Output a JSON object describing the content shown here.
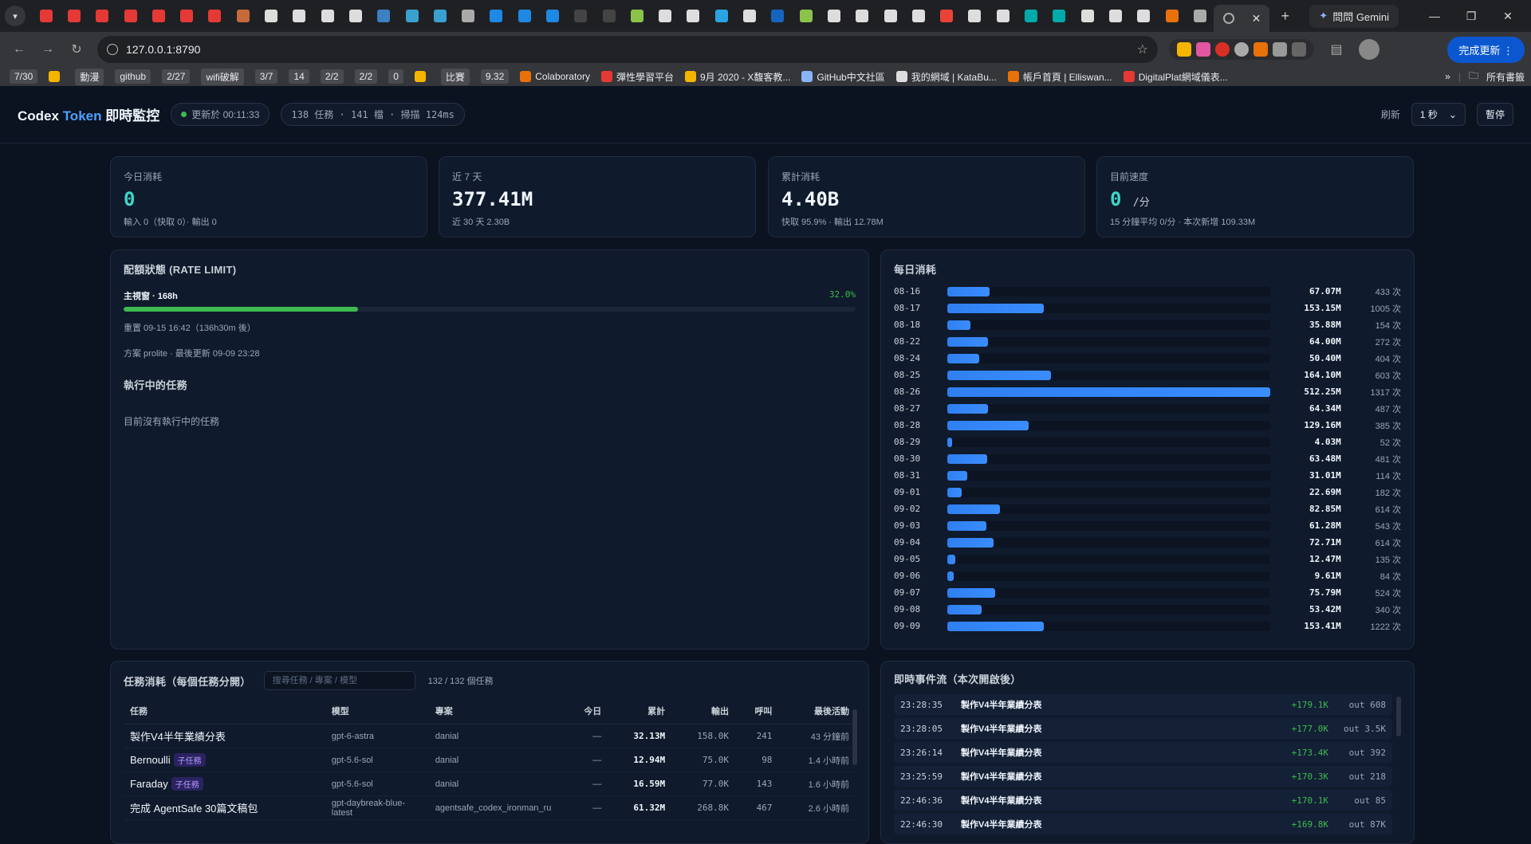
{
  "browser": {
    "gemini_label": "問問 Gemini",
    "url": "127.0.0.1:8790",
    "update_label": "完成更新",
    "bookmarks": [
      {
        "label": "7/30",
        "chip": true
      },
      {
        "label": "",
        "chip": false
      },
      {
        "label": "動漫",
        "chip": true
      },
      {
        "label": "github",
        "chip": true
      },
      {
        "label": "2/27",
        "chip": true
      },
      {
        "label": "wifi破解",
        "chip": true
      },
      {
        "label": "3/7",
        "chip": true
      },
      {
        "label": "14",
        "chip": true
      },
      {
        "label": "2/2",
        "chip": true
      },
      {
        "label": "2/2",
        "chip": true
      },
      {
        "label": "0",
        "chip": true
      },
      {
        "label": "",
        "chip": false
      },
      {
        "label": "比賽",
        "chip": true
      },
      {
        "label": "9.32",
        "chip": true
      },
      {
        "label": "Colaboratory",
        "chip": false
      },
      {
        "label": "彈性學習平台",
        "chip": false
      },
      {
        "label": "9月 2020 - X馥客教...",
        "chip": false
      },
      {
        "label": "GitHub中文社區",
        "chip": false
      },
      {
        "label": "我的網域 | KataBu...",
        "chip": false
      },
      {
        "label": "帳戶首頁 | Elliswan...",
        "chip": false
      },
      {
        "label": "DigitalPlat網域儀表...",
        "chip": false
      }
    ],
    "all_bookmarks_label": "所有書籤"
  },
  "app": {
    "brand_a": "Codex ",
    "brand_b": "Token",
    "brand_c": " 即時監控",
    "updated": "更新於 00:11:33",
    "stats": "138 任務 · 141 檔 · 掃描 124ms",
    "refresh_label": "刷新",
    "refresh_value": "1 秒",
    "pause_label": "暫停"
  },
  "kpis": [
    {
      "label": "今日消耗",
      "value": "0",
      "unit": "",
      "sub": "輸入 0（快取 0）· 輸出 0"
    },
    {
      "label": "近 7 天",
      "value": "377.41M",
      "unit": "",
      "sub": "近 30 天 2.30B"
    },
    {
      "label": "累計消耗",
      "value": "4.40B",
      "unit": "",
      "sub": "快取 95.9% · 輸出 12.78M"
    },
    {
      "label": "目前速度",
      "value": "0",
      "unit": "/分",
      "sub": "15 分鐘平均 0/分 · 本次新增 109.33M"
    }
  ],
  "rate": {
    "title": "配額狀態 (RATE LIMIT)",
    "window_label": "主視窗 · 168h",
    "percent_label": "32.0%",
    "percent": 32.0,
    "reset": "重置 09-15 16:42（136h30m 後）",
    "plan": "方案 prolite · 最後更新 09-09 23:28",
    "running_title": "執行中的任務",
    "running_empty": "目前沒有執行中的任務"
  },
  "daily": {
    "title": "每日消耗",
    "max": 512.25,
    "rows": [
      {
        "date": "08-16",
        "value": 67.07,
        "label": "67.07M",
        "count": "433 次"
      },
      {
        "date": "08-17",
        "value": 153.15,
        "label": "153.15M",
        "count": "1005 次"
      },
      {
        "date": "08-18",
        "value": 35.88,
        "label": "35.88M",
        "count": "154 次"
      },
      {
        "date": "08-22",
        "value": 64.0,
        "label": "64.00M",
        "count": "272 次"
      },
      {
        "date": "08-24",
        "value": 50.4,
        "label": "50.40M",
        "count": "404 次"
      },
      {
        "date": "08-25",
        "value": 164.1,
        "label": "164.10M",
        "count": "603 次"
      },
      {
        "date": "08-26",
        "value": 512.25,
        "label": "512.25M",
        "count": "1317 次"
      },
      {
        "date": "08-27",
        "value": 64.34,
        "label": "64.34M",
        "count": "487 次"
      },
      {
        "date": "08-28",
        "value": 129.16,
        "label": "129.16M",
        "count": "385 次"
      },
      {
        "date": "08-29",
        "value": 4.03,
        "label": "4.03M",
        "count": "52 次"
      },
      {
        "date": "08-30",
        "value": 63.48,
        "label": "63.48M",
        "count": "481 次"
      },
      {
        "date": "08-31",
        "value": 31.01,
        "label": "31.01M",
        "count": "114 次"
      },
      {
        "date": "09-01",
        "value": 22.69,
        "label": "22.69M",
        "count": "182 次"
      },
      {
        "date": "09-02",
        "value": 82.85,
        "label": "82.85M",
        "count": "614 次"
      },
      {
        "date": "09-03",
        "value": 61.28,
        "label": "61.28M",
        "count": "543 次"
      },
      {
        "date": "09-04",
        "value": 72.71,
        "label": "72.71M",
        "count": "614 次"
      },
      {
        "date": "09-05",
        "value": 12.47,
        "label": "12.47M",
        "count": "135 次"
      },
      {
        "date": "09-06",
        "value": 9.61,
        "label": "9.61M",
        "count": "84 次"
      },
      {
        "date": "09-07",
        "value": 75.79,
        "label": "75.79M",
        "count": "524 次"
      },
      {
        "date": "09-08",
        "value": 53.42,
        "label": "53.42M",
        "count": "340 次"
      },
      {
        "date": "09-09",
        "value": 153.41,
        "label": "153.41M",
        "count": "1222 次"
      }
    ]
  },
  "tasks": {
    "title": "任務消耗（每個任務分開）",
    "search_placeholder": "搜尋任務 / 專案 / 模型",
    "count": "132 / 132 個任務",
    "columns": [
      "任務",
      "模型",
      "專案",
      "今日",
      "累計",
      "輸出",
      "呼叫",
      "最後活動"
    ],
    "rows": [
      {
        "task": "製作V4半年業績分表",
        "tag": "",
        "model": "gpt-6-astra",
        "project": "danial",
        "today": "—",
        "total": "32.13M",
        "out": "158.0K",
        "calls": "241",
        "last": "43 分鐘前"
      },
      {
        "task": "Bernoulli",
        "tag": "子任務",
        "model": "gpt-5.6-sol",
        "project": "danial",
        "today": "—",
        "total": "12.94M",
        "out": "75.0K",
        "calls": "98",
        "last": "1.4 小時前"
      },
      {
        "task": "Faraday",
        "tag": "子任務",
        "model": "gpt-5.6-sol",
        "project": "danial",
        "today": "—",
        "total": "16.59M",
        "out": "77.0K",
        "calls": "143",
        "last": "1.6 小時前"
      },
      {
        "task": "完成 AgentSafe 30篇文稿包",
        "tag": "",
        "model": "gpt-daybreak-blue-latest",
        "project": "agentsafe_codex_ironman_ru",
        "today": "—",
        "total": "61.32M",
        "out": "268.8K",
        "calls": "467",
        "last": "2.6 小時前"
      }
    ]
  },
  "events": {
    "title": "即時事件流（本次開啟後）",
    "rows": [
      {
        "time": "23:28:35",
        "name": "製作V4半年業績分表",
        "plus": "+179.1K",
        "out": "out 608"
      },
      {
        "time": "23:28:05",
        "name": "製作V4半年業績分表",
        "plus": "+177.0K",
        "out": "out 3.5K"
      },
      {
        "time": "23:26:14",
        "name": "製作V4半年業績分表",
        "plus": "+173.4K",
        "out": "out 392"
      },
      {
        "time": "23:25:59",
        "name": "製作V4半年業績分表",
        "plus": "+170.3K",
        "out": "out 218"
      },
      {
        "time": "22:46:36",
        "name": "製作V4半年業績分表",
        "plus": "+170.1K",
        "out": "out 85"
      },
      {
        "time": "22:46:30",
        "name": "製作V4半年業績分表",
        "plus": "+169.8K",
        "out": "out 87K"
      }
    ]
  },
  "colors": {
    "accent": "#4ea1ff",
    "bar": "#2f7ff0",
    "green": "#3fb950",
    "teal": "#3dd6c8",
    "bg": "#0b1220"
  }
}
